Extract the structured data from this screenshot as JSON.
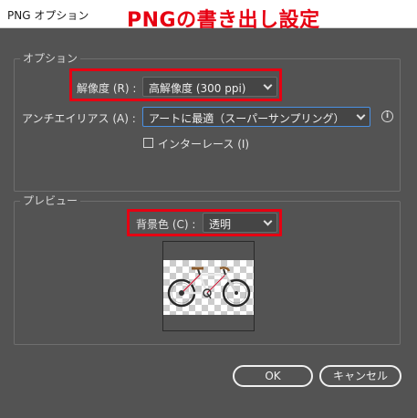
{
  "window": {
    "title": "PNG オプション"
  },
  "annotation": {
    "title": "PNGの書き出し設定",
    "color": "#e60012"
  },
  "options": {
    "section_label": "オプション",
    "resolution": {
      "label": "解像度 (R) :",
      "value": "高解像度 (300 ppi)"
    },
    "antialias": {
      "label": "アンチエイリアス (A) :",
      "value": "アートに最適（スーパーサンプリング）"
    },
    "interlace": {
      "label": "インターレース (I)",
      "checked": false
    }
  },
  "preview": {
    "section_label": "プレビュー",
    "background": {
      "label": "背景色 (C) :",
      "value": "透明"
    }
  },
  "buttons": {
    "ok": "OK",
    "cancel": "キャンセル"
  },
  "colors": {
    "dialog_bg": "#535353",
    "focus": "#4a90e2",
    "highlight": "#e60012"
  }
}
